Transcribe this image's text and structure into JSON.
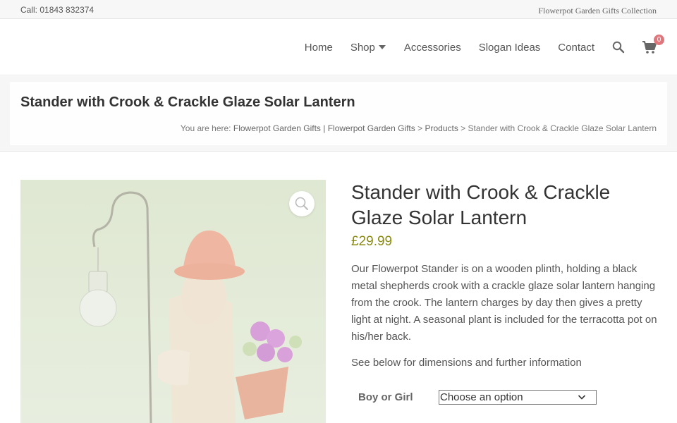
{
  "topbar": {
    "call": "Call: 01843 832374",
    "collection": "Flowerpot Garden Gifts Collection"
  },
  "nav": {
    "items": [
      {
        "label": "Home"
      },
      {
        "label": "Shop"
      },
      {
        "label": "Accessories"
      },
      {
        "label": "Slogan Ideas"
      },
      {
        "label": "Contact"
      }
    ],
    "search_icon": "search-icon",
    "cart_icon": "cart-icon",
    "cart_count": "0"
  },
  "page": {
    "title": "Stander with Crook & Crackle Glaze Solar Lantern",
    "breadcrumb": {
      "prefix": "You are here:",
      "crumb1": "Flowerpot Garden Gifts | Flowerpot Garden Gifts",
      "sep1": ">",
      "crumb2": "Products",
      "sep2": ">",
      "current": "Stander with Crook & Crackle Glaze Solar Lantern"
    }
  },
  "product": {
    "title": "Stander with Crook & Crackle Glaze Solar Lantern",
    "price": "£29.99",
    "description": "Our Flowerpot Stander is on a wooden plinth, holding a black metal shepherds crook with a crackle glaze solar lantern hanging from the crook. The lantern charges by day then gives a pretty light at night.  A seasonal plant is included for the terracotta pot on his/her back.",
    "see_below": "See below for dimensions and further information",
    "variation_label": "Boy or Girl",
    "variation_selected": "Choose an option",
    "zoom_icon": "magnifier-icon"
  },
  "colors": {
    "accent_price": "#8a8a12",
    "cart_badge": "#e0777d"
  }
}
